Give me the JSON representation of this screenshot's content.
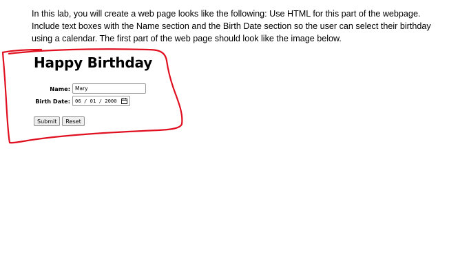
{
  "instructions": {
    "line1": "In this lab, you will create a web page looks like the following: Use HTML for this part of the webpage.",
    "line2": "Include text boxes with the Name section and the Birth Date section so the user can select their birthday",
    "line3": "using a calendar. The first part of the web page should look like the image below."
  },
  "form": {
    "heading": "Happy Birthday",
    "name_label": "Name:",
    "name_value": "Mary",
    "birth_label": "Birth Date:",
    "birth_value": "06 / 01 / 2000",
    "submit_label": "Submit",
    "reset_label": "Reset"
  },
  "colors": {
    "annotation": "#e01020"
  },
  "icons": {
    "date_picker": "calendar-icon"
  }
}
